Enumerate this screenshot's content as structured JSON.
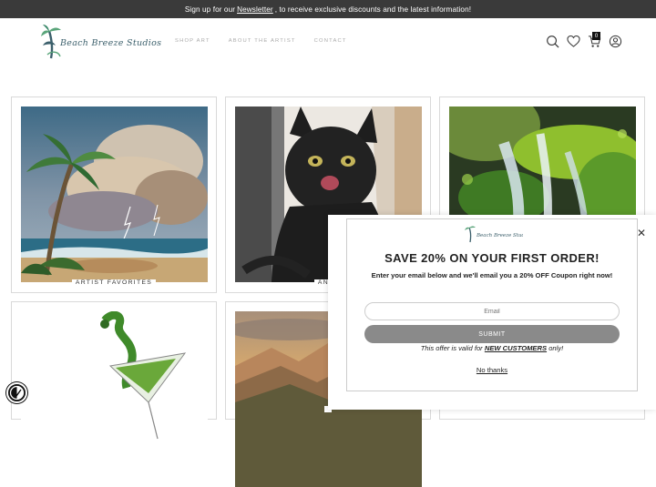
{
  "announcement": {
    "before": "Sign up for our",
    "link": "Newsletter",
    "after": ", to receive exclusive discounts and the latest information!"
  },
  "brand": {
    "logo_text": "Beach Breeze Studios",
    "colors": {
      "teal": "#3b5f6b",
      "green": "#5aa57a"
    }
  },
  "nav": {
    "items": [
      {
        "label": "SHOP ART"
      },
      {
        "label": "ABOUT THE ARTIST"
      },
      {
        "label": "CONTACT"
      }
    ]
  },
  "header_icons": {
    "search": "search-icon",
    "wishlist": "heart-icon",
    "cart": "cart-icon",
    "account": "user-icon",
    "cart_count": "0"
  },
  "collections": [
    {
      "caption": "ARTIST FAVORITES",
      "image": "palm-tree-storm-painting"
    },
    {
      "caption": "ANIM",
      "image": "black-kitten-painting"
    },
    {
      "caption": "",
      "image": "mossy-waterfall-photo"
    },
    {
      "caption": "",
      "image": "green-martini-splash"
    },
    {
      "caption": "",
      "image": "mountain-sunset-painting"
    },
    {
      "caption": "",
      "image": ""
    }
  ],
  "popup": {
    "title": "SAVE 20% ON YOUR FIRST ORDER!",
    "subtitle": "Enter your email below and we'll email you a 20% OFF Coupon right now!",
    "email_placeholder": "Email",
    "submit_label": "SUBMIT",
    "offer_prefix": "This offer is valid for",
    "offer_highlight": "NEW CUSTOMERS",
    "offer_suffix": "only!",
    "decline_label": "No thanks",
    "close_icon": "close-icon"
  },
  "accessibility": {
    "icon": "accessibility-icon"
  }
}
